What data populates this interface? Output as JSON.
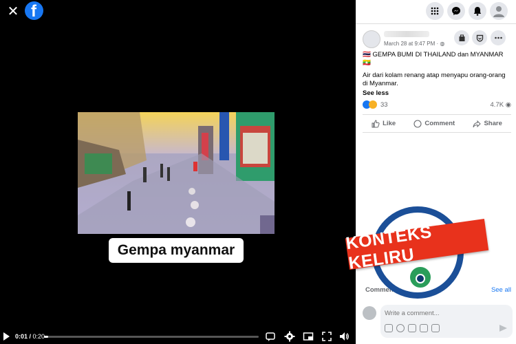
{
  "viewer": {
    "close_label": "✕",
    "logo_letter": "f",
    "caption": "Gempa myanmar",
    "time_current": "0:01",
    "time_total": "0:20",
    "progress_fraction": 0.02
  },
  "post": {
    "date": "March 28 at 9:47 PM · ",
    "line1": "🇹🇭 GEMPA BUMI DI THAILAND dan MYANMAR 🇲🇲",
    "line2": "Air dari kolam renang atap menyapu orang-orang di Myanmar.",
    "see_less": "See less",
    "reactions_count": "33",
    "views": "4.7K",
    "actions": {
      "like": "Like",
      "comment": "Comment",
      "share": "Share"
    },
    "comments_label": "Comment",
    "see_all": "See all",
    "comment_placeholder": "Write a comment..."
  },
  "stamp": {
    "text": "KONTEKS KELIRU",
    "color": "#e8321c",
    "ring_color": "#1b4f98"
  },
  "colors": {
    "fb_blue": "#1877f2"
  }
}
